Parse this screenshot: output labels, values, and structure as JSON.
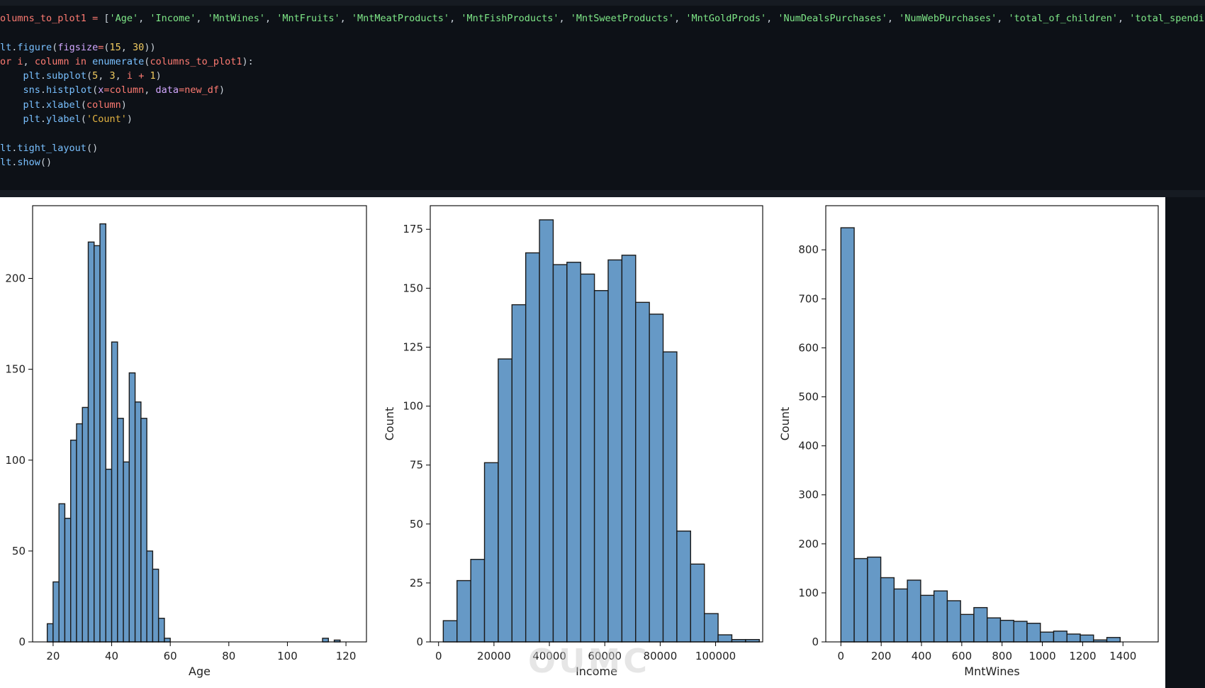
{
  "code": {
    "lines": [
      [
        [
          "tk-var",
          "olumns_to_plot1"
        ],
        [
          "tk-plain",
          " "
        ],
        [
          "tk-op",
          "="
        ],
        [
          "tk-plain",
          " ["
        ],
        [
          "tk-str",
          "'Age'"
        ],
        [
          "tk-plain",
          ", "
        ],
        [
          "tk-str",
          "'Income'"
        ],
        [
          "tk-plain",
          ", "
        ],
        [
          "tk-str",
          "'MntWines'"
        ],
        [
          "tk-plain",
          ", "
        ],
        [
          "tk-str",
          "'MntFruits'"
        ],
        [
          "tk-plain",
          ", "
        ],
        [
          "tk-str",
          "'MntMeatProducts'"
        ],
        [
          "tk-plain",
          ", "
        ],
        [
          "tk-str",
          "'MntFishProducts'"
        ],
        [
          "tk-plain",
          ", "
        ],
        [
          "tk-str",
          "'MntSweetProducts'"
        ],
        [
          "tk-plain",
          ", "
        ],
        [
          "tk-str",
          "'MntGoldProds'"
        ],
        [
          "tk-plain",
          ", "
        ],
        [
          "tk-str",
          "'NumDealsPurchases'"
        ],
        [
          "tk-plain",
          ", "
        ],
        [
          "tk-str",
          "'NumWebPurchases'"
        ],
        [
          "tk-plain",
          ", "
        ],
        [
          "tk-str",
          "'total_of_children'"
        ],
        [
          "tk-plain",
          ", "
        ],
        [
          "tk-str",
          "'total_spendi"
        ]
      ],
      [],
      [
        [
          "tk-fn",
          "lt"
        ],
        [
          "tk-plain",
          "."
        ],
        [
          "tk-fn",
          "figure"
        ],
        [
          "tk-plain",
          "("
        ],
        [
          "tk-param",
          "figsize"
        ],
        [
          "tk-op",
          "="
        ],
        [
          "tk-plain",
          "("
        ],
        [
          "tk-num",
          "15"
        ],
        [
          "tk-plain",
          ", "
        ],
        [
          "tk-num",
          "30"
        ],
        [
          "tk-plain",
          "))"
        ]
      ],
      [
        [
          "tk-kw",
          "or"
        ],
        [
          "tk-plain",
          " "
        ],
        [
          "tk-var",
          "i"
        ],
        [
          "tk-plain",
          ", "
        ],
        [
          "tk-var",
          "column"
        ],
        [
          "tk-plain",
          " "
        ],
        [
          "tk-kw",
          "in"
        ],
        [
          "tk-plain",
          " "
        ],
        [
          "tk-fn",
          "enumerate"
        ],
        [
          "tk-plain",
          "("
        ],
        [
          "tk-var",
          "columns_to_plot1"
        ],
        [
          "tk-plain",
          "):"
        ]
      ],
      [
        [
          "tk-plain",
          "    "
        ],
        [
          "tk-fn",
          "plt"
        ],
        [
          "tk-plain",
          "."
        ],
        [
          "tk-fn",
          "subplot"
        ],
        [
          "tk-plain",
          "("
        ],
        [
          "tk-num",
          "5"
        ],
        [
          "tk-plain",
          ", "
        ],
        [
          "tk-num",
          "3"
        ],
        [
          "tk-plain",
          ", "
        ],
        [
          "tk-var",
          "i"
        ],
        [
          "tk-plain",
          " "
        ],
        [
          "tk-op",
          "+"
        ],
        [
          "tk-plain",
          " "
        ],
        [
          "tk-num",
          "1"
        ],
        [
          "tk-plain",
          ")"
        ]
      ],
      [
        [
          "tk-plain",
          "    "
        ],
        [
          "tk-fn",
          "sns"
        ],
        [
          "tk-plain",
          "."
        ],
        [
          "tk-fn",
          "histplot"
        ],
        [
          "tk-plain",
          "("
        ],
        [
          "tk-param",
          "x"
        ],
        [
          "tk-op",
          "="
        ],
        [
          "tk-var",
          "column"
        ],
        [
          "tk-plain",
          ", "
        ],
        [
          "tk-param",
          "data"
        ],
        [
          "tk-op",
          "="
        ],
        [
          "tk-var",
          "new_df"
        ],
        [
          "tk-plain",
          ")"
        ]
      ],
      [
        [
          "tk-plain",
          "    "
        ],
        [
          "tk-fn",
          "plt"
        ],
        [
          "tk-plain",
          "."
        ],
        [
          "tk-fn",
          "xlabel"
        ],
        [
          "tk-plain",
          "("
        ],
        [
          "tk-var",
          "column"
        ],
        [
          "tk-plain",
          ")"
        ]
      ],
      [
        [
          "tk-plain",
          "    "
        ],
        [
          "tk-fn",
          "plt"
        ],
        [
          "tk-plain",
          "."
        ],
        [
          "tk-fn",
          "ylabel"
        ],
        [
          "tk-plain",
          "("
        ],
        [
          "tk-gold",
          "'Count'"
        ],
        [
          "tk-plain",
          ")"
        ]
      ],
      [],
      [
        [
          "tk-fn",
          "lt"
        ],
        [
          "tk-plain",
          "."
        ],
        [
          "tk-fn",
          "tight_layout"
        ],
        [
          "tk-plain",
          "()"
        ]
      ],
      [
        [
          "tk-fn",
          "lt"
        ],
        [
          "tk-plain",
          "."
        ],
        [
          "tk-fn",
          "show"
        ],
        [
          "tk-plain",
          "()"
        ]
      ]
    ]
  },
  "colors": {
    "bar_fill": "#6699c6",
    "bar_edge": "#1a1a1a",
    "axis": "#000000"
  },
  "watermark": "OUMC",
  "chart_data": [
    {
      "type": "bar",
      "xlabel": "Age",
      "ylabel": "",
      "xlim": [
        13,
        127
      ],
      "ylim": [
        0,
        240
      ],
      "xticks": [
        20,
        40,
        60,
        80,
        100,
        120
      ],
      "yticks": [
        0,
        50,
        100,
        150,
        200
      ],
      "bin_edges": [
        18,
        20,
        22,
        24,
        26,
        28,
        30,
        32,
        34,
        36,
        38,
        40,
        42,
        44,
        46,
        48,
        50,
        52,
        54,
        56,
        58,
        60,
        62,
        64,
        66,
        68,
        70,
        72,
        74,
        76,
        78,
        80,
        82,
        84,
        86,
        88,
        90,
        92,
        94,
        96,
        98,
        100,
        102,
        104,
        106,
        108,
        110,
        112,
        114,
        116,
        118,
        120,
        122
      ],
      "values": [
        10,
        33,
        76,
        68,
        111,
        120,
        129,
        220,
        218,
        230,
        95,
        165,
        123,
        99,
        148,
        132,
        123,
        50,
        40,
        13,
        2,
        0,
        0,
        0,
        0,
        0,
        0,
        0,
        0,
        0,
        0,
        0,
        0,
        0,
        0,
        0,
        0,
        0,
        0,
        0,
        0,
        0,
        0,
        0,
        0,
        0,
        0,
        2,
        0,
        1,
        0,
        0
      ]
    },
    {
      "type": "bar",
      "xlabel": "Income",
      "ylabel": "Count",
      "xlim": [
        -3000,
        117000
      ],
      "ylim": [
        0,
        185
      ],
      "xticks": [
        0,
        20000,
        40000,
        60000,
        80000,
        100000
      ],
      "yticks": [
        0,
        25,
        50,
        75,
        100,
        125,
        150,
        175
      ],
      "bin_edges": [
        1700,
        6660,
        11620,
        16580,
        21540,
        26500,
        31460,
        36420,
        41380,
        46340,
        51300,
        56260,
        61220,
        66180,
        71140,
        76100,
        81060,
        86020,
        90980,
        95940,
        100900,
        105860,
        110820,
        115780
      ],
      "values": [
        9,
        26,
        35,
        76,
        120,
        143,
        165,
        179,
        160,
        161,
        156,
        149,
        162,
        164,
        144,
        139,
        123,
        47,
        33,
        12,
        3,
        1,
        1
      ]
    },
    {
      "type": "bar",
      "xlabel": "MntWines",
      "ylabel": "Count",
      "xlim": [
        -75,
        1575
      ],
      "ylim": [
        0,
        890
      ],
      "xticks": [
        0,
        200,
        400,
        600,
        800,
        1000,
        1200,
        1400
      ],
      "yticks": [
        0,
        100,
        200,
        300,
        400,
        500,
        600,
        700,
        800
      ],
      "bin_edges": [
        0,
        66,
        132,
        198,
        264,
        330,
        396,
        462,
        528,
        594,
        660,
        726,
        792,
        858,
        924,
        990,
        1056,
        1122,
        1188,
        1254,
        1320,
        1386,
        1452,
        1518
      ],
      "values": [
        845,
        170,
        173,
        131,
        108,
        126,
        95,
        104,
        84,
        56,
        70,
        49,
        44,
        42,
        38,
        20,
        22,
        16,
        14,
        4,
        9
      ]
    }
  ]
}
